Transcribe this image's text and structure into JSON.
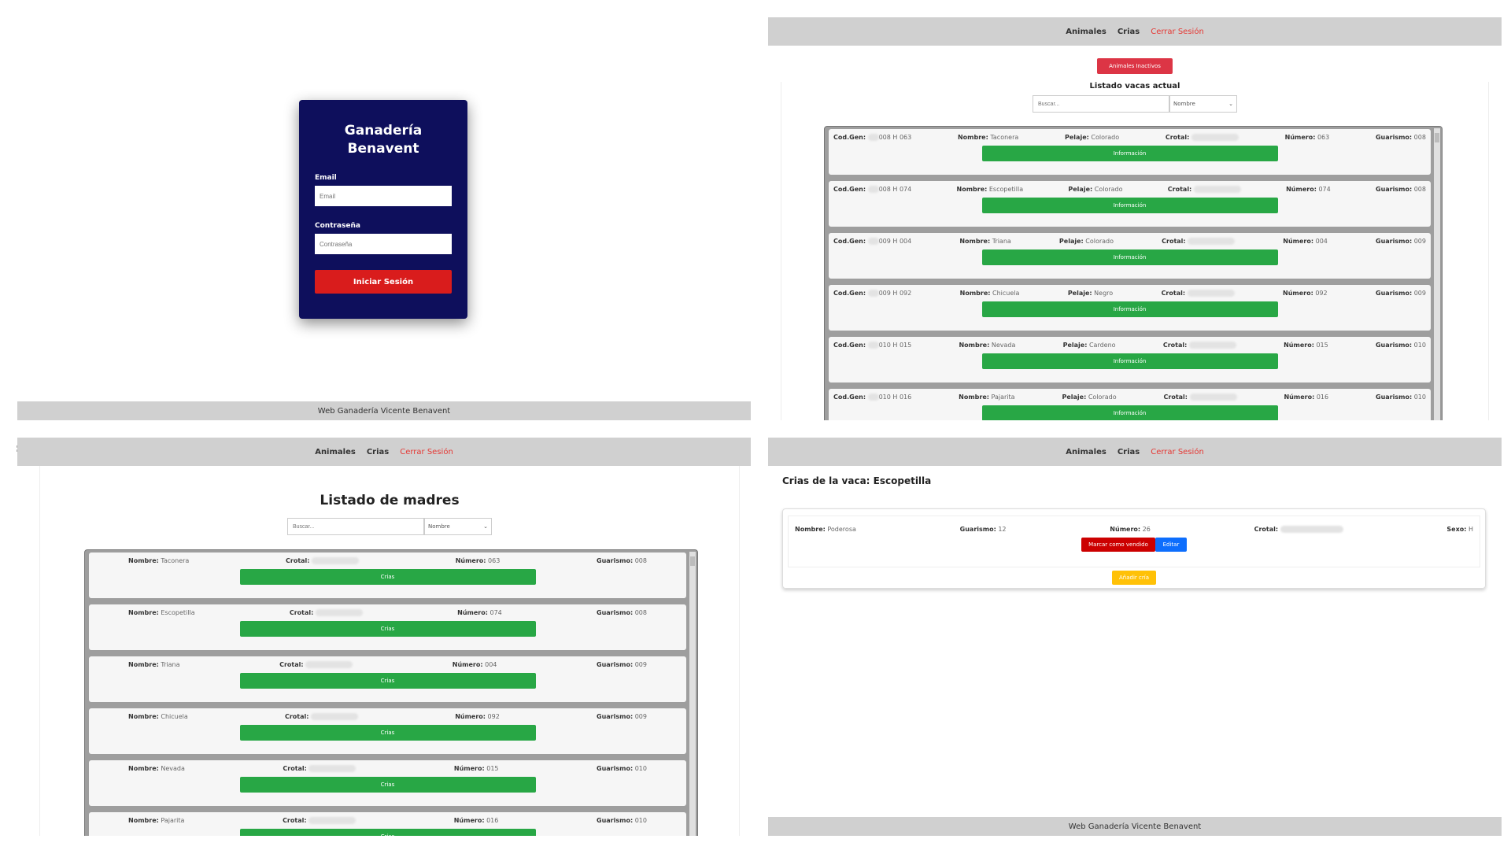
{
  "nav": {
    "animales": "Animales",
    "crias": "Crias",
    "logout": "Cerrar Sesión"
  },
  "footer": "Web Ganadería Vicente Benavent",
  "side_mark": ":",
  "login": {
    "title": "Ganadería Benavent",
    "email_label": "Email",
    "email_placeholder": "Email",
    "password_label": "Contraseña",
    "password_placeholder": "Contraseña",
    "submit": "Iniciar Sesión"
  },
  "vacas": {
    "inactive_button": "Animales Inactivos",
    "title": "Listado vacas actual",
    "search_placeholder": "Buscar...",
    "sort_option": "Nombre",
    "labels": {
      "codgen": "Cod.Gen:",
      "nombre": "Nombre:",
      "pelaje": "Pelaje:",
      "crotal": "Crotal:",
      "numero": "Número:",
      "guarismo": "Guarismo:"
    },
    "info_button": "Información",
    "rows": [
      {
        "codgen": "008 H 063",
        "nombre": "Taconera",
        "pelaje": "Colorado",
        "numero": "063",
        "guarismo": "008"
      },
      {
        "codgen": "008 H 074",
        "nombre": "Escopetilla",
        "pelaje": "Colorado",
        "numero": "074",
        "guarismo": "008"
      },
      {
        "codgen": "009 H 004",
        "nombre": "Triana",
        "pelaje": "Colorado",
        "numero": "004",
        "guarismo": "009"
      },
      {
        "codgen": "009 H 092",
        "nombre": "Chicuela",
        "pelaje": "Negro",
        "numero": "092",
        "guarismo": "009"
      },
      {
        "codgen": "010 H 015",
        "nombre": "Nevada",
        "pelaje": "Cardeno",
        "numero": "015",
        "guarismo": "010"
      },
      {
        "codgen": "010 H 016",
        "nombre": "Pajarita",
        "pelaje": "Colorado",
        "numero": "016",
        "guarismo": "010"
      }
    ]
  },
  "madres": {
    "title": "Listado de madres",
    "search_placeholder": "Buscar...",
    "sort_option": "Nombre",
    "labels": {
      "nombre": "Nombre:",
      "crotal": "Crotal:",
      "numero": "Número:",
      "guarismo": "Guarismo:"
    },
    "crias_button": "Crias",
    "rows": [
      {
        "nombre": "Taconera",
        "numero": "063",
        "guarismo": "008"
      },
      {
        "nombre": "Escopetilla",
        "numero": "074",
        "guarismo": "008"
      },
      {
        "nombre": "Triana",
        "numero": "004",
        "guarismo": "009"
      },
      {
        "nombre": "Chicuela",
        "numero": "092",
        "guarismo": "009"
      },
      {
        "nombre": "Nevada",
        "numero": "015",
        "guarismo": "010"
      },
      {
        "nombre": "Pajarita",
        "numero": "016",
        "guarismo": "010"
      }
    ]
  },
  "crias": {
    "title": "Crias de la vaca: Escopetilla",
    "labels": {
      "nombre": "Nombre:",
      "guarismo": "Guarismo:",
      "numero": "Número:",
      "crotal": "Crotal:",
      "sexo": "Sexo:"
    },
    "item": {
      "nombre": "Poderosa",
      "guarismo": "12",
      "numero": "26",
      "sexo": "H"
    },
    "sold_button": "Marcar como vendido",
    "edit_button": "Editar",
    "add_button": "Añadir cría"
  }
}
